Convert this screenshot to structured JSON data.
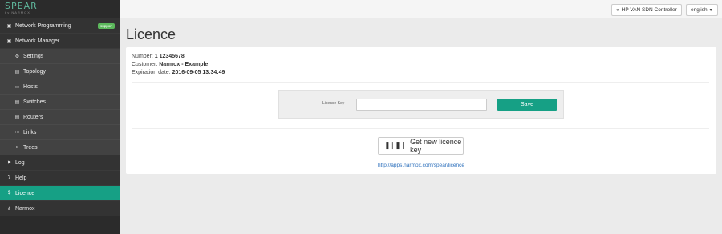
{
  "logo": {
    "brand": "SPEAR",
    "sub": "by NARMOX"
  },
  "sidebar": {
    "items": [
      {
        "label": "Network Programming",
        "icon": "briefcase-icon",
        "badge": "support"
      },
      {
        "label": "Network Manager",
        "icon": "briefcase-icon"
      },
      {
        "label": "Settings",
        "icon": "gear-icon"
      },
      {
        "label": "Topology",
        "icon": "map-icon"
      },
      {
        "label": "Hosts",
        "icon": "laptop-icon"
      },
      {
        "label": "Switches",
        "icon": "hdd-icon"
      },
      {
        "label": "Routers",
        "icon": "hdd-icon"
      },
      {
        "label": "Links",
        "icon": "dots-icon"
      },
      {
        "label": "Trees",
        "icon": "share-icon"
      },
      {
        "label": "Log",
        "icon": "flag-icon"
      },
      {
        "label": "Help",
        "icon": "question-icon"
      },
      {
        "label": "Licence",
        "icon": "dollar-icon"
      },
      {
        "label": "Narmox",
        "icon": "fork-icon"
      }
    ]
  },
  "topbar": {
    "controller_label": "HP VAN SDN Controller",
    "language_label": "english"
  },
  "page": {
    "title": "Licence"
  },
  "licence": {
    "number_label": "Number:",
    "number_value": "1 12345678",
    "customer_label": "Customer:",
    "customer_value": "Narmox - Example",
    "expiration_label": "Expiration date:",
    "expiration_value": "2016-09-05 13:34:49"
  },
  "form": {
    "key_label": "Licence Key",
    "key_value": "",
    "save_label": "Save"
  },
  "get_key": {
    "button_label": "Get new licence key",
    "link_text": "http://apps.narmox.com/spear/licence"
  },
  "colors": {
    "accent": "#16a085",
    "sidebar": "#2b2b2b",
    "link": "#2a6ebb"
  }
}
